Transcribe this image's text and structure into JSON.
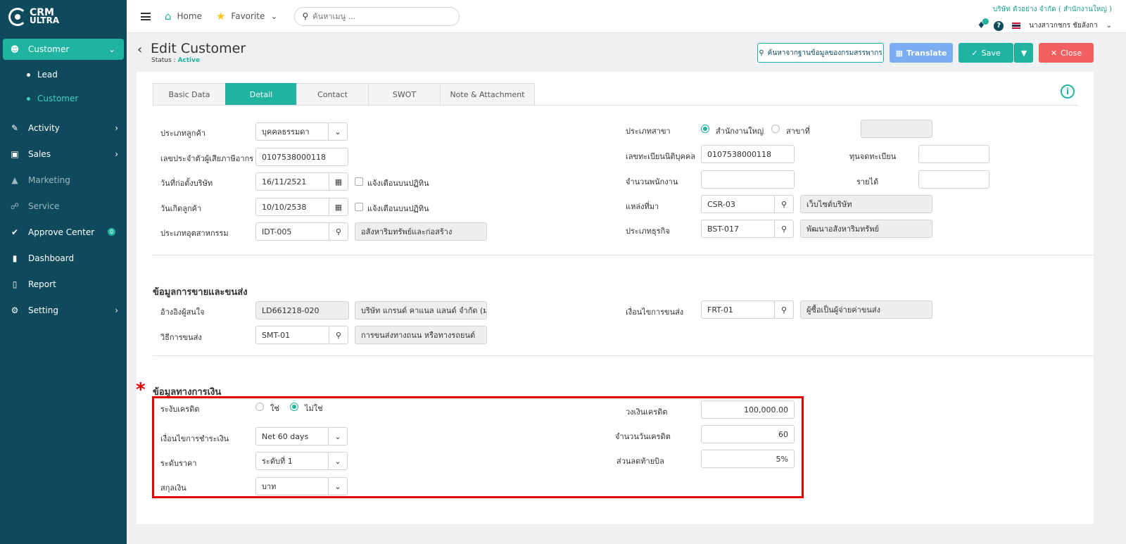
{
  "app": {
    "logo_line1": "CRM",
    "logo_line2": "ULTRA"
  },
  "sidebar": {
    "items": [
      {
        "label": "Customer",
        "icon": "users-icon"
      },
      {
        "label": "Lead"
      },
      {
        "label": "Customer"
      },
      {
        "label": "Activity",
        "icon": "chat-icon"
      },
      {
        "label": "Sales",
        "icon": "money-icon"
      },
      {
        "label": "Marketing",
        "icon": "megaphone-icon"
      },
      {
        "label": "Service",
        "icon": "headset-icon"
      },
      {
        "label": "Approve Center",
        "icon": "check-icon",
        "badge": "0"
      },
      {
        "label": "Dashboard",
        "icon": "bar-chart-icon"
      },
      {
        "label": "Report",
        "icon": "file-icon"
      },
      {
        "label": "Setting",
        "icon": "gear-icon"
      }
    ]
  },
  "topbar": {
    "home": "Home",
    "favorite": "Favorite",
    "search_placeholder": "ค้นหาเมนู ...",
    "company": "บริษัท ตัวอย่าง จำกัด ( สำนักงานใหญ่ )",
    "user": "นางสาวกชกร ชัยลังกา"
  },
  "header": {
    "title": "Edit Customer",
    "status_label": "Status : ",
    "status_value": "Active",
    "btn_search_db": "ค้นหาจากฐานข้อมูลของกรมสรรพากร",
    "btn_translate": "Translate",
    "btn_save": "Save",
    "btn_close": "Close"
  },
  "tabs": [
    "Basic Data",
    "Detail",
    "Contact",
    "SWOT",
    "Note & Attachment"
  ],
  "detail": {
    "customer_type_label": "ประเภทลูกค้า",
    "customer_type": "บุคคลธรรมดา",
    "tax_id_label": "เลขประจำตัวผู้เสียภาษีอากร",
    "tax_id": "0107538000118",
    "founded_label": "วันที่ก่อตั้งบริษัท",
    "founded": "16/11/2521",
    "remind_label": "แจ้งเตือนบนปฏิทิน",
    "birthday_label": "วันเกิดลูกค้า",
    "birthday": "10/10/2538",
    "industry_label": "ประเภทอุตสาหกรรม",
    "industry_code": "IDT-005",
    "industry_name": "อสังหาริมทรัพย์และก่อสร้าง",
    "branch_type_label": "ประเภทสาขา",
    "branch_hq": "สำนักงานใหญ่",
    "branch_sub": "สาขาที่",
    "reg_no_label": "เลขทะเบียนนิติบุคคล",
    "reg_no": "0107538000118",
    "capital_label": "ทุนจดทะเบียน",
    "employees_label": "จำนวนพนักงาน",
    "revenue_label": "รายได้",
    "source_label": "แหล่งที่มา",
    "source_code": "CSR-03",
    "source_name": "เว็บไซต์บริษัท",
    "business_label": "ประเภทธุรกิจ",
    "business_code": "BST-017",
    "business_name": "พัฒนาอสังหาริมทรัพย์"
  },
  "sales": {
    "title": "ข้อมูลการขายและขนส่ง",
    "lead_ref_label": "อ้างอิงผู้สนใจ",
    "lead_ref_code": "LD661218-020",
    "lead_ref_name": "บริษัท แกรนด์ คาแนล แลนด์ จำกัด (มห",
    "ship_method_label": "วิธีการขนส่ง",
    "ship_method_code": "SMT-01",
    "ship_method_name": "การขนส่งทางถนน หรือทางรถยนต์",
    "ship_term_label": "เงื่อนไขการขนส่ง",
    "ship_term_code": "FRT-01",
    "ship_term_name": "ผู้ซื้อเป็นผู้จ่ายค่าขนส่ง"
  },
  "finance": {
    "title": "ข้อมูลทางการเงิน",
    "hold_credit_label": "ระงับเครดิต",
    "yes": "ใช่",
    "no": "ไม่ใช่",
    "payment_term_label": "เงื่อนไขการชำระเงิน",
    "payment_term": "Net 60 days",
    "price_level_label": "ระดับราคา",
    "price_level": "ระดับที่ 1",
    "currency_label": "สกุลเงิน",
    "currency": "บาท",
    "credit_limit_label": "วงเงินเครดิต",
    "credit_limit": "100,000.00",
    "credit_days_label": "จำนวนวันเครดิต",
    "credit_days": "60",
    "discount_label": "ส่วนลดท้ายบิล",
    "discount": "5%"
  },
  "annotation": {
    "asterisk": "*",
    "highlight_color": "#e00000"
  },
  "colors": {
    "accent": "#1fb3a0",
    "sidebar": "#0e4a5c",
    "close": "#f06060",
    "translate": "#7aaef0"
  }
}
